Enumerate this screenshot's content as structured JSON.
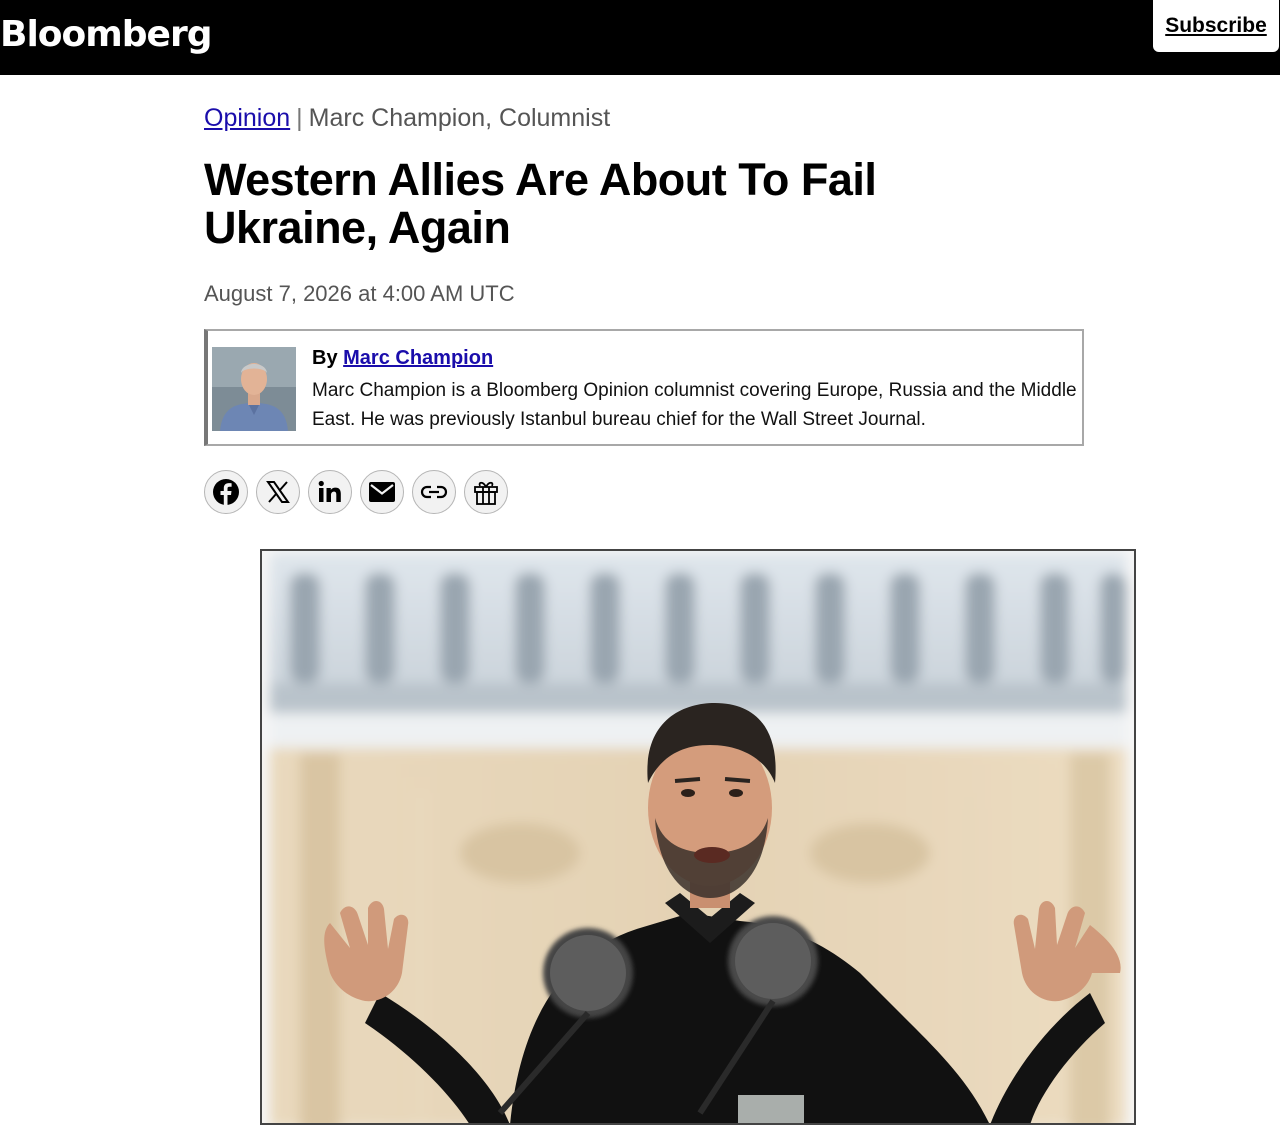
{
  "header": {
    "logo": "Bloomberg",
    "subscribe_label": "Subscribe"
  },
  "article": {
    "section": "Opinion",
    "separator": "|",
    "author_role": "Marc Champion, Columnist",
    "headline": "Western Allies Are About To Fail Ukraine, Again",
    "dateline": "August 7, 2026 at 4:00 AM UTC",
    "byline_prefix": "By",
    "author_name": "Marc Champion",
    "author_bio": "Marc Champion is a Bloomberg Opinion columnist covering Europe, Russia and the Middle East. He was previously Istanbul bureau chief for the Wall Street Journal."
  },
  "share_icons": [
    "facebook-icon",
    "x-icon",
    "linkedin-icon",
    "email-icon",
    "link-icon",
    "gift-icon"
  ],
  "colors": {
    "topbar": "#000000",
    "link": "#1a0dab",
    "meta_text": "#555555"
  }
}
